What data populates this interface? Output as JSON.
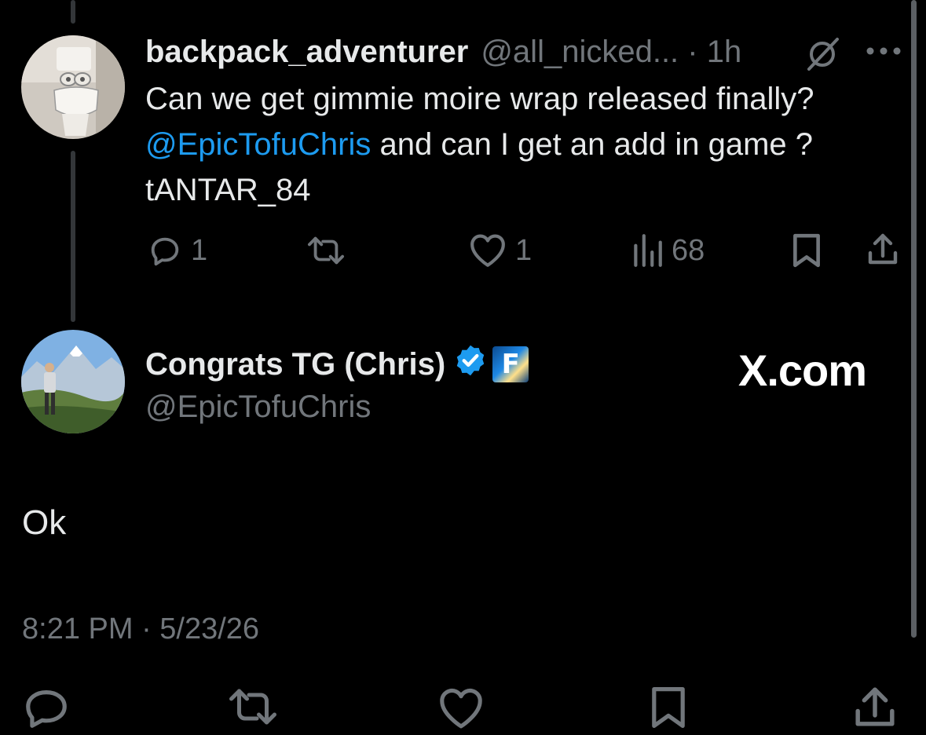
{
  "reply_tweet": {
    "display_name": "backpack_adventurer",
    "handle_time": "@all_nicked... · 1h",
    "text_before_mention": "Can we get gimmie moire wrap released finally? ",
    "mention": "@EpicTofuChris",
    "text_after_mention": " and can I get an add in game ? tANTAR_84",
    "actions": {
      "reply_count": "1",
      "like_count": "1",
      "views_count": "68"
    }
  },
  "main_tweet": {
    "display_name": "Congrats TG (Chris)",
    "handle": "@EpicTofuChris",
    "watermark": "X.com",
    "text": "Ok",
    "timestamp": "8:21 PM · 5/23/26",
    "verified_color": "#1d9bf0",
    "affiliate_badge_letter": "F"
  },
  "colors": {
    "background": "#000000",
    "text": "#e7e9ea",
    "muted": "#71767b",
    "link": "#1d9bf0"
  }
}
